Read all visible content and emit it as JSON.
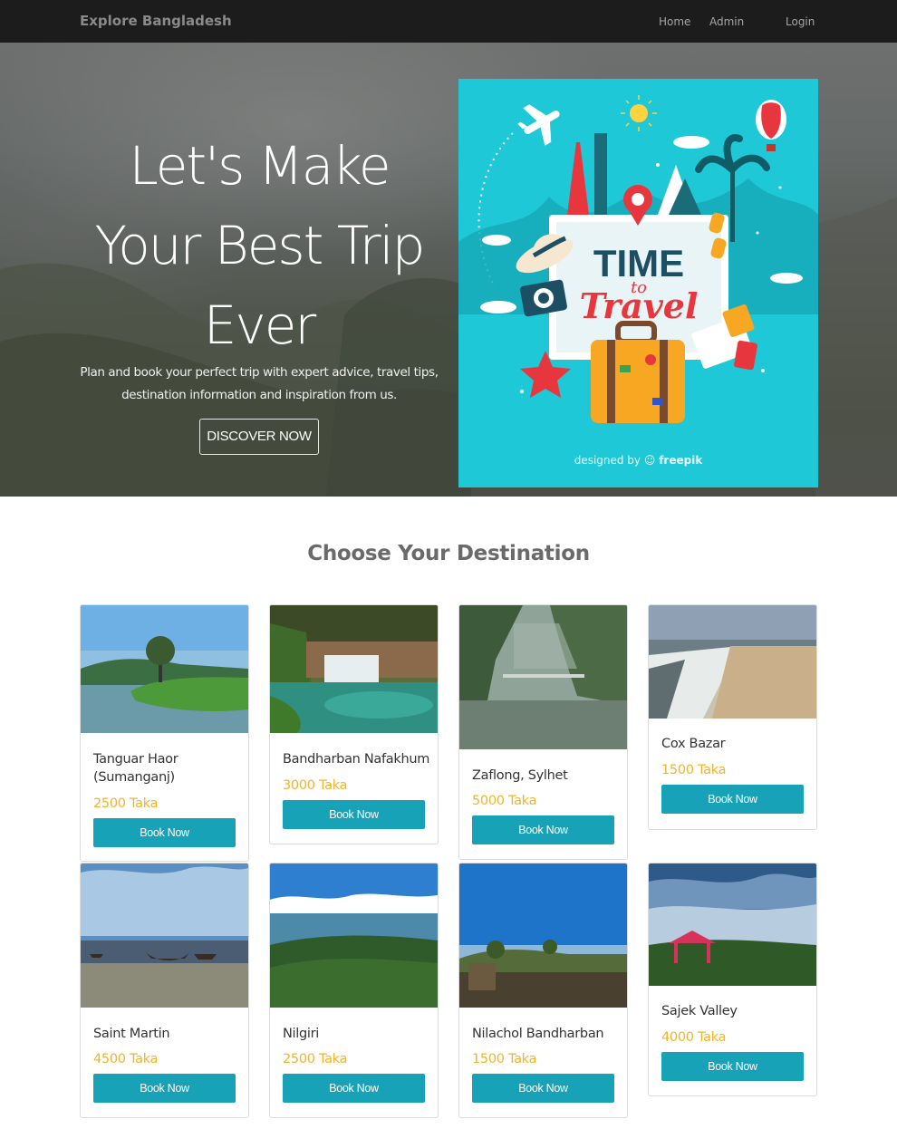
{
  "navbar": {
    "brand": "Explore Bangladesh",
    "links": [
      "Home",
      "Admin",
      "Login"
    ]
  },
  "hero": {
    "title_lines": [
      "Let's Make",
      "Your Best Trip",
      "Ever"
    ],
    "subtitle_lines": [
      "Plan and book your perfect trip with expert advice, travel tips,",
      "destination information and inspiration from us."
    ],
    "button": "DISCOVER NOW",
    "poster": {
      "headline": "TIME",
      "small": "to",
      "script": "Travel",
      "credit_prefix": "designed by",
      "credit_brand": "freepik"
    }
  },
  "section": {
    "title": "Choose Your Destination"
  },
  "destinations": [
    {
      "name": "Tanguar Haor (Sumanganj)",
      "price": "2500 Taka",
      "button": "Book Now"
    },
    {
      "name": "Bandharban Nafakhum",
      "price": "3000 Taka",
      "button": "Book Now"
    },
    {
      "name": "Zaflong, Sylhet",
      "price": "5000 Taka",
      "button": "Book Now"
    },
    {
      "name": "Cox Bazar",
      "price": "1500 Taka",
      "button": "Book Now"
    },
    {
      "name": "Saint Martin",
      "price": "4500 Taka",
      "button": "Book Now"
    },
    {
      "name": "Nilgiri",
      "price": "2500 Taka",
      "button": "Book Now"
    },
    {
      "name": "Nilachol Bandharban",
      "price": "1500 Taka",
      "button": "Book Now"
    },
    {
      "name": "Sajek Valley",
      "price": "4000 Taka",
      "button": "Book Now"
    }
  ],
  "colors": {
    "navbar_bg": "#1c1c1c",
    "price": "#f0b429",
    "button": "#17a2b8",
    "poster_bg": "#1ec8d6"
  }
}
